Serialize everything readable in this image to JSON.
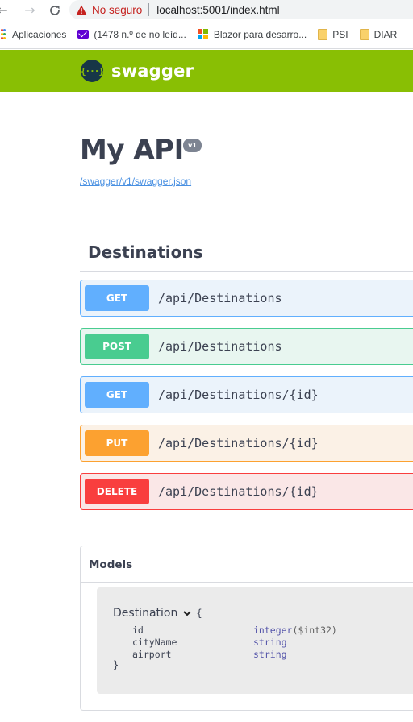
{
  "browser": {
    "security_label": "No seguro",
    "url": "localhost:5001/index.html",
    "bookmarks": [
      {
        "label": "Aplicaciones",
        "icon": "apps-grid-icon"
      },
      {
        "label": "(1478 n.º de no leíd...",
        "icon": "yahoo-mail-icon"
      },
      {
        "label": "Blazor para desarro...",
        "icon": "microsoft-logo-icon"
      },
      {
        "label": "PSI",
        "icon": "folder-icon"
      },
      {
        "label": "DIAR",
        "icon": "folder-icon"
      }
    ]
  },
  "topbar": {
    "logo_text": "swagger",
    "logo_glyph": "{···}",
    "background": "#89bf04"
  },
  "info": {
    "title": "My API",
    "version": "v1",
    "spec_link": "/swagger/v1/swagger.json"
  },
  "tag": {
    "name": "Destinations"
  },
  "operations": [
    {
      "method": "GET",
      "path": "/api/Destinations",
      "color": "#61affe",
      "bg": "#ebf3fb"
    },
    {
      "method": "POST",
      "path": "/api/Destinations",
      "color": "#49cc90",
      "bg": "#e8f6f0"
    },
    {
      "method": "GET",
      "path": "/api/Destinations/{id}",
      "color": "#61affe",
      "bg": "#ebf3fb"
    },
    {
      "method": "PUT",
      "path": "/api/Destinations/{id}",
      "color": "#fca130",
      "bg": "#fbf1e6"
    },
    {
      "method": "DELETE",
      "path": "/api/Destinations/{id}",
      "color": "#f93e3e",
      "bg": "#fae7e7"
    }
  ],
  "models": {
    "title": "Models",
    "schema": {
      "name": "Destination",
      "open_brace": "{",
      "close_brace": "}",
      "properties": [
        {
          "name": "id",
          "type": "integer",
          "format": "($int32)"
        },
        {
          "name": "cityName",
          "type": "string",
          "format": ""
        },
        {
          "name": "airport",
          "type": "string",
          "format": ""
        }
      ]
    }
  }
}
